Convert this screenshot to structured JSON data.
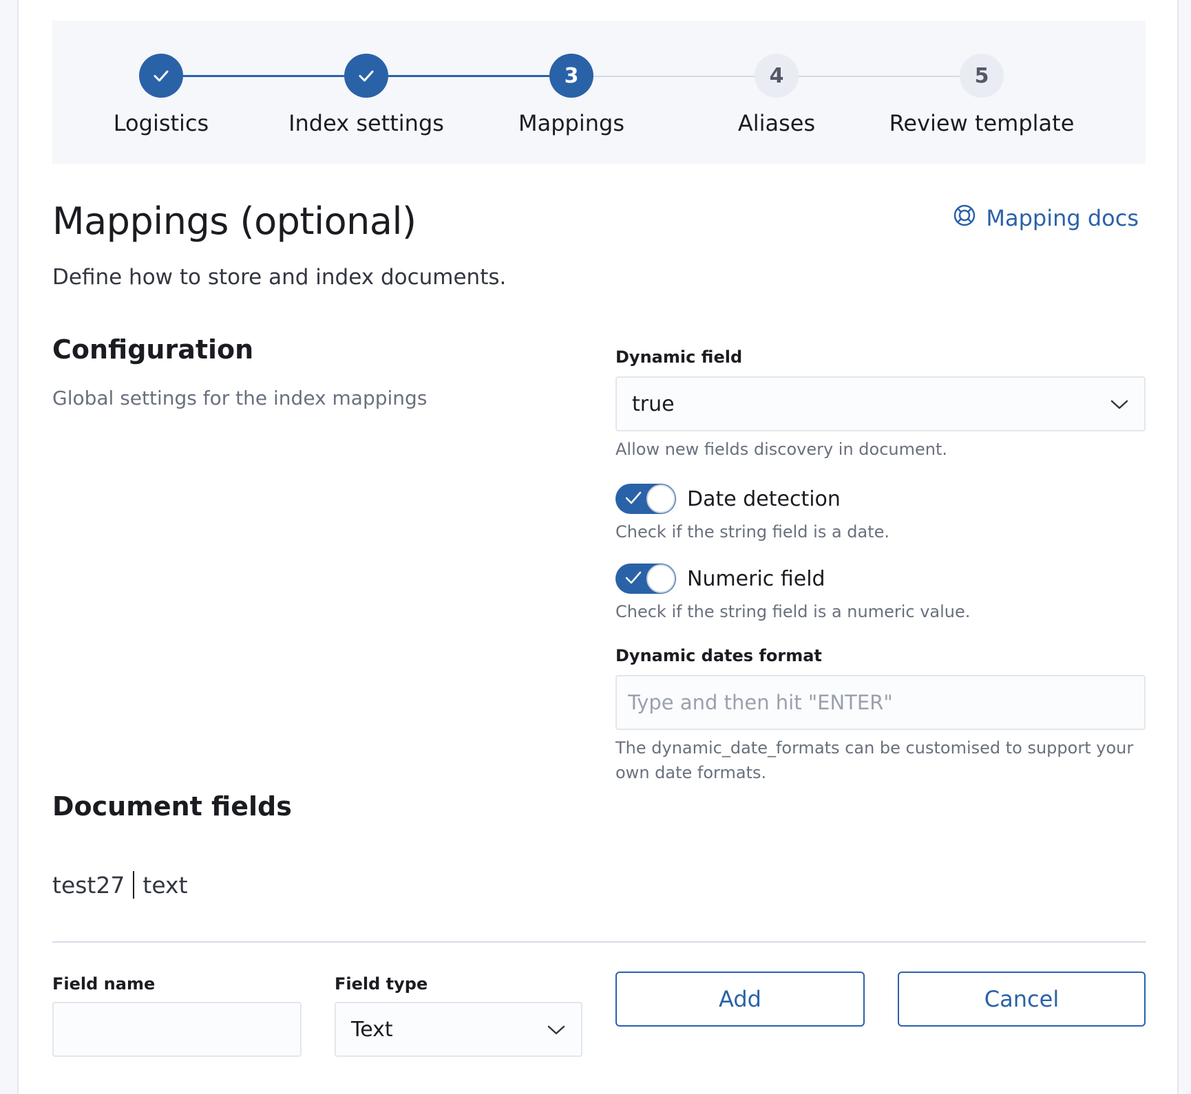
{
  "stepper": {
    "steps": [
      {
        "number": "1",
        "title": "Logistics",
        "status": "complete"
      },
      {
        "number": "2",
        "title": "Index settings",
        "status": "complete"
      },
      {
        "number": "3",
        "title": "Mappings",
        "status": "current"
      },
      {
        "number": "4",
        "title": "Aliases",
        "status": "incomplete"
      },
      {
        "number": "5",
        "title": "Review template",
        "status": "incomplete"
      }
    ]
  },
  "header": {
    "title": "Mappings (optional)",
    "description": "Define how to store and index documents.",
    "docs_link": "Mapping docs",
    "docs_icon": "lifebuoy-icon"
  },
  "configuration": {
    "title": "Configuration",
    "description": "Global settings for the index mappings",
    "dynamic_field": {
      "label": "Dynamic field",
      "value": "true",
      "help": "Allow new fields discovery in document."
    },
    "date_detection": {
      "label": "Date detection",
      "checked": true,
      "help": "Check if the string field is a date."
    },
    "numeric_field": {
      "label": "Numeric field",
      "checked": true,
      "help": "Check if the string field is a numeric value."
    },
    "dynamic_dates_format": {
      "label": "Dynamic dates format",
      "placeholder": "Type and then hit \"ENTER\"",
      "help": "The dynamic_date_formats can be customised to support your own date formats."
    }
  },
  "document_fields": {
    "title": "Document fields",
    "fields": [
      {
        "name": "test27",
        "type": "text"
      }
    ],
    "form": {
      "field_name_label": "Field name",
      "field_name_value": "",
      "field_type_label": "Field type",
      "field_type_value": "Text",
      "add_label": "Add",
      "cancel_label": "Cancel"
    }
  },
  "colors": {
    "primary": "#2a62a8",
    "inactive_step": "#e9edf3",
    "panel_bg": "#f5f7fa"
  }
}
